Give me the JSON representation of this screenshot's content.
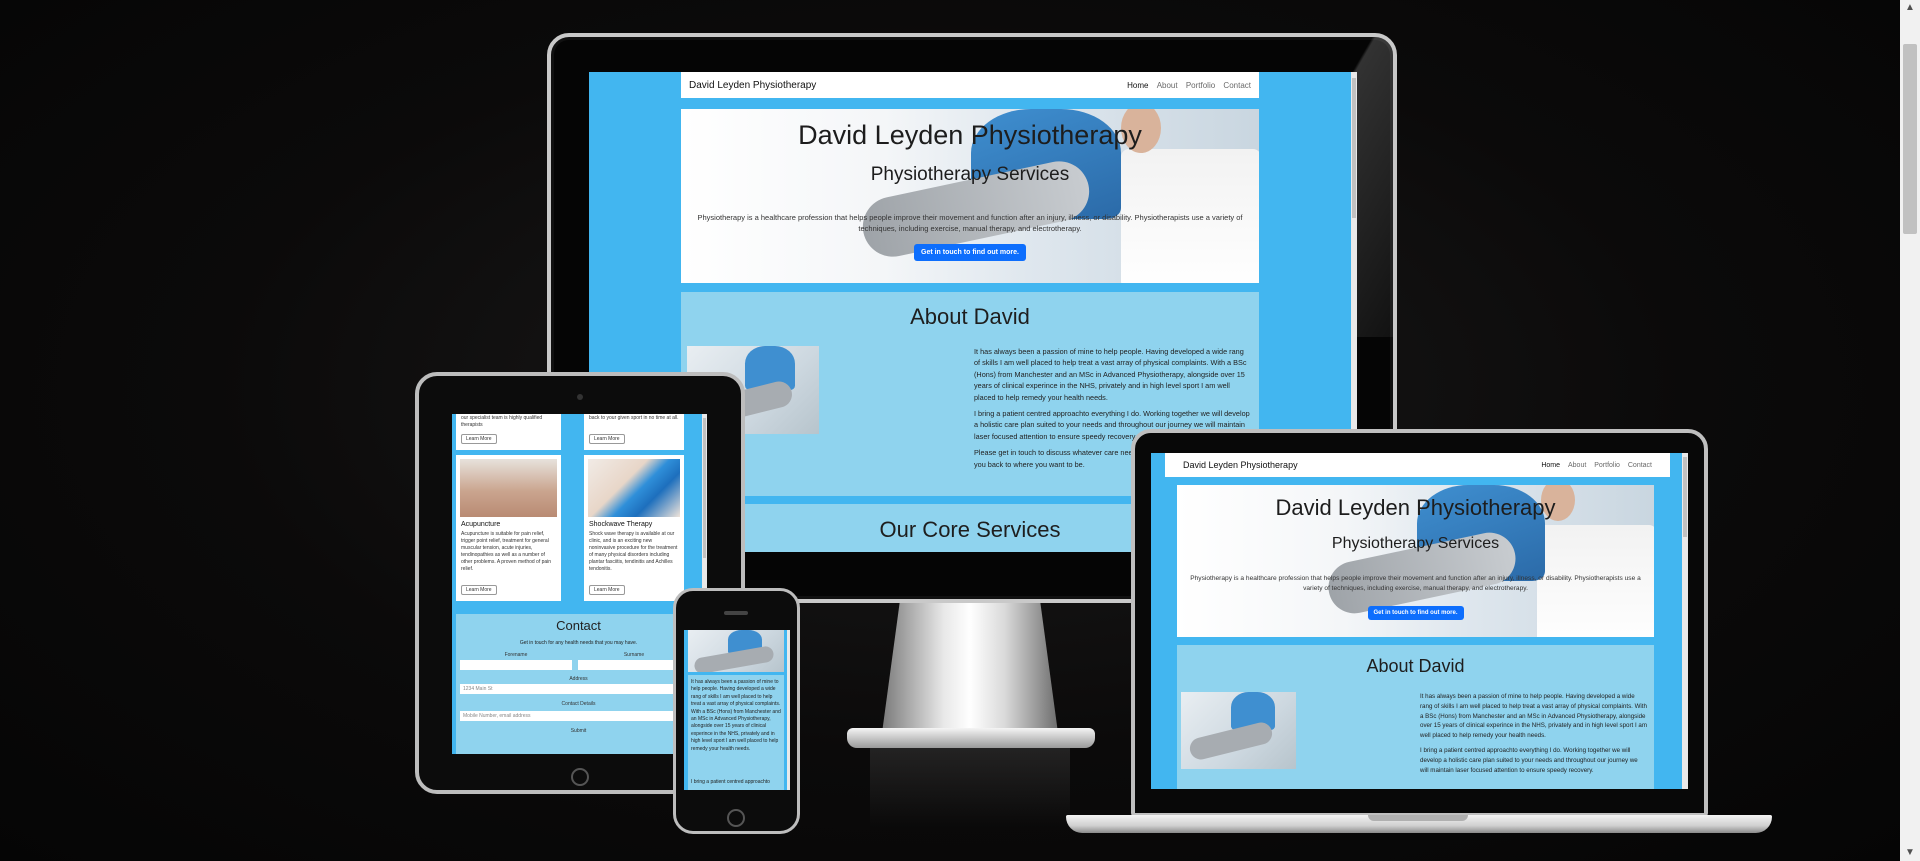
{
  "site": {
    "brand": "David Leyden Physiotherapy",
    "nav": [
      "Home",
      "About",
      "Portfolio",
      "Contact"
    ],
    "hero_title": "David Leyden Physiotherapy",
    "hero_subtitle": "Physiotherapy Services",
    "hero_text": "Physiotherapy is a healthcare profession that helps people improve their movement and function after an injury, illness, or disability. Physiotherapists use a variety of techniques, including exercise, manual therapy, and electrotherapy.",
    "hero_button": "Get in touch to find out more.",
    "about_title": "About David",
    "about_p1": "It has always been a passion of mine to help people. Having developed a wide rang of skills I am well placed to help treat a vast array of physical complaints. With a BSc (Hons) from Manchester and an MSc in Advanced Physiotherapy, alongside over 15 years of clinical experince in the NHS, privately and in high level sport I am well placed to help remedy your health needs.",
    "about_p2": "I bring a patient centred approachto everything I do. Working together we will develop a holistic care plan suited to your needs and throughout our journey we will maintain laser focused attention to ensure speedy recovery.",
    "about_p3": "Please get in touch to discuss whatever care needs you may have and how I can get you back to where you want to be.",
    "services_title": "Our Core Services"
  },
  "tablet": {
    "card1_top": "our specialist team is highly qualified therapists",
    "card2_top": "back to your given sport in no time at all.",
    "learn_more": "Learn More",
    "card3_title": "Acupuncture",
    "card3_text": "Acupuncture is suitable for pain relief, trigger point relief, treatment for general muscular tension, acute injuries, tendinopathies as well as a number of other problems. A proven method of pain relief.",
    "card4_title": "Shockwave Therapy",
    "card4_text": "Shock wave therapy is available at our clinic, and is an exciting new noninvasive procedure for the treatment of many physical disorders including plantar fasciitis, tendinitis and Achilles tendonitis.",
    "contact_title": "Contact",
    "contact_sub": "Get in touch for any health needs that you may have.",
    "forename": "Forename",
    "surname": "Surname",
    "address": "Address",
    "address_ph": "1234 Main St",
    "contact_details": "Contact Details",
    "contact_ph": "Mobile Number, email address",
    "submit": "Submit"
  },
  "phone": {
    "p1": "It has always been a passion of mine to help people. Having developed a wide rang of skills I am well placed to help treat a vast array of physical complaints. With a BSc (Hons) from Manchester and an MSc in Advanced Physiotherapy, alongside over 15 years of clinical experince in the NHS, privately and in high level sport I am well placed to help remedy your health needs.",
    "p2": "I bring a patient centred approachto"
  },
  "colors": {
    "site_bg": "#42b6f0",
    "about_bg": "#8fd3ee",
    "button": "#0d6efd"
  }
}
